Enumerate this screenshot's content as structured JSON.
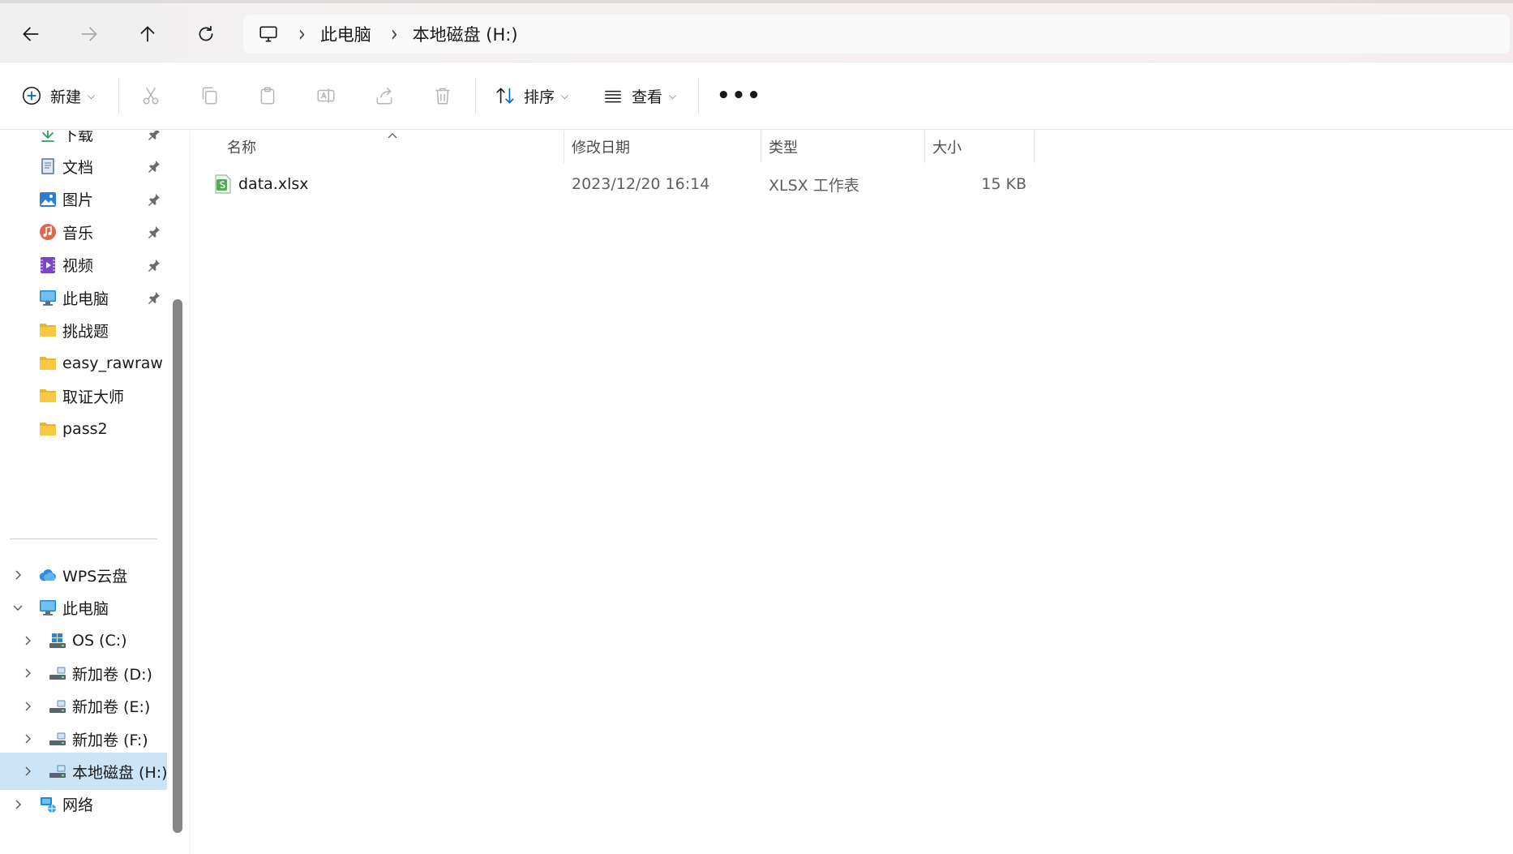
{
  "address_bar": {
    "breadcrumbs": [
      "此电脑",
      "本地磁盘 (H:)"
    ]
  },
  "toolbar": {
    "new_label": "新建",
    "sort_label": "排序",
    "view_label": "查看",
    "more_label": "•••"
  },
  "sidebar": {
    "quick_access": [
      {
        "label": "下载",
        "icon": "download-icon",
        "pinned": true
      },
      {
        "label": "文档",
        "icon": "document-icon",
        "pinned": true
      },
      {
        "label": "图片",
        "icon": "pictures-icon",
        "pinned": true
      },
      {
        "label": "音乐",
        "icon": "music-icon",
        "pinned": true
      },
      {
        "label": "视频",
        "icon": "video-icon",
        "pinned": true
      },
      {
        "label": "此电脑",
        "icon": "computer-icon",
        "pinned": true
      },
      {
        "label": "挑战题",
        "icon": "folder-icon",
        "pinned": false
      },
      {
        "label": "easy_rawraw",
        "icon": "folder-icon",
        "pinned": false
      },
      {
        "label": "取证大师",
        "icon": "folder-icon",
        "pinned": false
      },
      {
        "label": "pass2",
        "icon": "folder-icon",
        "pinned": false
      }
    ],
    "tree": [
      {
        "label": "WPS云盘",
        "icon": "cloud-icon",
        "expanded": false
      },
      {
        "label": "此电脑",
        "icon": "computer-icon",
        "expanded": true
      },
      {
        "label": "OS (C:)",
        "icon": "windows-drive-icon",
        "expanded": false
      },
      {
        "label": "新加卷 (D:)",
        "icon": "drive-icon",
        "expanded": false
      },
      {
        "label": "新加卷 (E:)",
        "icon": "drive-icon",
        "expanded": false
      },
      {
        "label": "新加卷 (F:)",
        "icon": "drive-icon",
        "expanded": false
      },
      {
        "label": "本地磁盘 (H:)",
        "icon": "drive-icon",
        "expanded": false,
        "selected": true
      },
      {
        "label": "网络",
        "icon": "network-icon",
        "expanded": false
      }
    ]
  },
  "file_list": {
    "columns": [
      "名称",
      "修改日期",
      "类型",
      "大小"
    ],
    "rows": [
      {
        "name": "data.xlsx",
        "modified": "2023/12/20 16:14",
        "type": "XLSX 工作表",
        "size": "15 KB",
        "icon": "spreadsheet-icon"
      }
    ]
  },
  "colors": {
    "selected_bg": "#cce4f7",
    "accent_blue": "#0067c0",
    "folder_yellow": "#f7c843",
    "spreadsheet_green": "#4caf50"
  }
}
